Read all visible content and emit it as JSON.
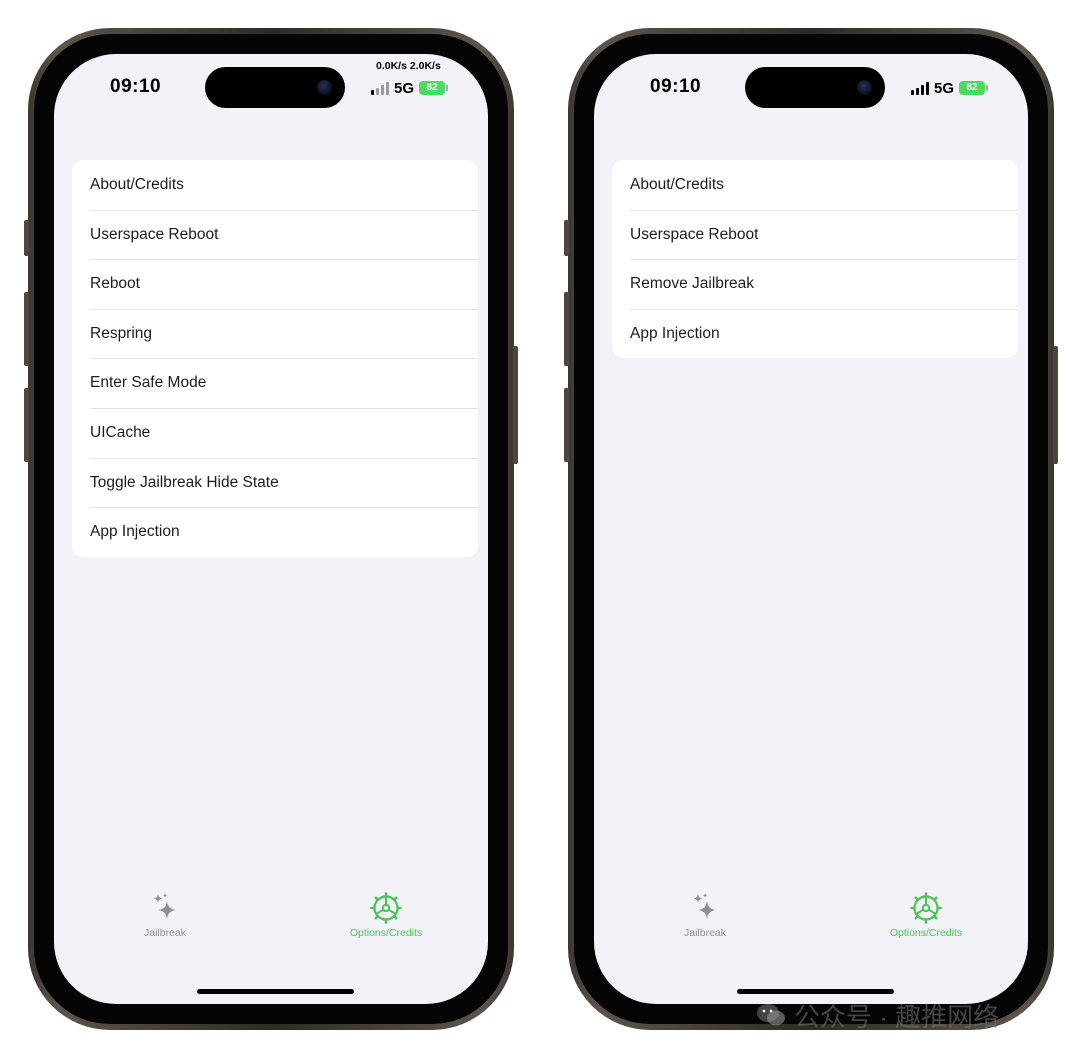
{
  "colors": {
    "accent_green": "#4cc35a",
    "inactive_gray": "#8e8e93",
    "screen_bg": "#f2f2f7",
    "battery_green": "#4cd964"
  },
  "phones": [
    {
      "status": {
        "time": "09:10",
        "network_speed": "0.0K/s 2.0K/s",
        "carrier": "5G",
        "battery": "82"
      },
      "menu": [
        "About/Credits",
        "Userspace Reboot",
        "Reboot",
        "Respring",
        "Enter Safe Mode",
        "UICache",
        "Toggle Jailbreak Hide State",
        "App Injection"
      ],
      "tabs": [
        {
          "label": "Jailbreak",
          "icon": "sparkles-icon",
          "active": false
        },
        {
          "label": "Options/Credits",
          "icon": "gear-icon",
          "active": true
        }
      ]
    },
    {
      "status": {
        "time": "09:10",
        "carrier": "5G",
        "battery": "82"
      },
      "menu": [
        "About/Credits",
        "Userspace Reboot",
        "Remove Jailbreak",
        "App Injection"
      ],
      "tabs": [
        {
          "label": "Jailbreak",
          "icon": "sparkles-icon",
          "active": false
        },
        {
          "label": "Options/Credits",
          "icon": "gear-icon",
          "active": true
        }
      ]
    }
  ],
  "watermark": {
    "text": "公众号 · 趣推网络",
    "icon": "wechat-icon"
  }
}
